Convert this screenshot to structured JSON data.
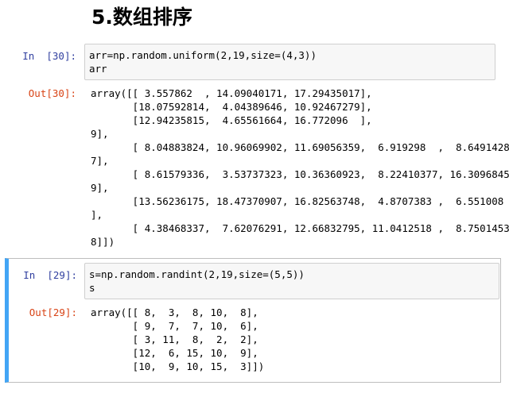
{
  "section_heading": "5.数组排序",
  "cells": [
    {
      "in_prompt": "In  [30]:",
      "code": [
        "arr=np.random.uniform(2,19,size=(4,3))",
        "arr"
      ],
      "out_prompt": "Out[30]:",
      "output": [
        "array([[ 3.557862  , 14.09040171, 17.29435017],",
        "       [18.07592814,  4.04389646, 10.92467279],",
        "       [12.94235815,  4.65561664, 16.772096  ],",
        "9],",
        "       [ 8.04883824, 10.96069902, 11.69056359,  6.919298  ,  8.6491428",
        "7],",
        "       [ 8.61579336,  3.53737323, 10.36360923,  8.22410377, 16.3096845",
        "9],",
        "       [13.56236175, 18.47370907, 16.82563748,  4.8707383 ,  6.551008",
        "],",
        "       [ 4.38468337,  7.62076291, 12.66832795, 11.0412518 ,  8.7501453",
        "8]])"
      ]
    },
    {
      "in_prompt": "In  [29]:",
      "code": [
        "s=np.random.randint(2,19,size=(5,5))",
        "s"
      ],
      "out_prompt": "Out[29]:",
      "output": [
        "array([[ 8,  3,  8, 10,  8],",
        "       [ 9,  7,  7, 10,  6],",
        "       [ 3, 11,  8,  2,  2],",
        "       [12,  6, 15, 10,  9],",
        "       [10,  9, 10, 15,  3]])"
      ]
    }
  ]
}
